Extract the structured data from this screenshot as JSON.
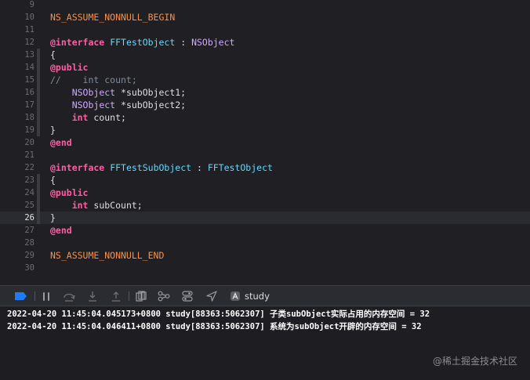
{
  "editor": {
    "current_line": 26,
    "lines": [
      {
        "n": "9",
        "bar": false,
        "tokens": []
      },
      {
        "n": "10",
        "bar": false,
        "tokens": [
          {
            "c": "t-macro",
            "t": "NS_ASSUME_NONNULL_BEGIN"
          }
        ]
      },
      {
        "n": "11",
        "bar": false,
        "tokens": []
      },
      {
        "n": "12",
        "bar": false,
        "tokens": [
          {
            "c": "t-kw",
            "t": "@interface"
          },
          {
            "c": "t-plain",
            "t": " "
          },
          {
            "c": "t-type",
            "t": "FFTestObject"
          },
          {
            "c": "t-plain",
            "t": " : "
          },
          {
            "c": "t-sys",
            "t": "NSObject"
          }
        ]
      },
      {
        "n": "13",
        "bar": true,
        "tokens": [
          {
            "c": "t-plain",
            "t": "{"
          }
        ]
      },
      {
        "n": "14",
        "bar": true,
        "tokens": [
          {
            "c": "t-kw",
            "t": "@public"
          }
        ]
      },
      {
        "n": "15",
        "bar": true,
        "tokens": [
          {
            "c": "t-cmt",
            "t": "//    int count;"
          }
        ]
      },
      {
        "n": "16",
        "bar": true,
        "tokens": [
          {
            "c": "t-plain",
            "t": "    "
          },
          {
            "c": "t-sys",
            "t": "NSObject"
          },
          {
            "c": "t-plain",
            "t": " *subObject1;"
          }
        ]
      },
      {
        "n": "17",
        "bar": true,
        "tokens": [
          {
            "c": "t-plain",
            "t": "    "
          },
          {
            "c": "t-sys",
            "t": "NSObject"
          },
          {
            "c": "t-plain",
            "t": " *subObject2;"
          }
        ]
      },
      {
        "n": "18",
        "bar": true,
        "tokens": [
          {
            "c": "t-plain",
            "t": "    "
          },
          {
            "c": "t-kw",
            "t": "int"
          },
          {
            "c": "t-plain",
            "t": " count;"
          }
        ]
      },
      {
        "n": "19",
        "bar": true,
        "tokens": [
          {
            "c": "t-plain",
            "t": "}"
          }
        ]
      },
      {
        "n": "20",
        "bar": false,
        "tokens": [
          {
            "c": "t-kw",
            "t": "@end"
          }
        ]
      },
      {
        "n": "21",
        "bar": false,
        "tokens": []
      },
      {
        "n": "22",
        "bar": false,
        "tokens": [
          {
            "c": "t-kw",
            "t": "@interface"
          },
          {
            "c": "t-plain",
            "t": " "
          },
          {
            "c": "t-type",
            "t": "FFTestSubObject"
          },
          {
            "c": "t-plain",
            "t": " : "
          },
          {
            "c": "t-type",
            "t": "FFTestObject"
          }
        ]
      },
      {
        "n": "23",
        "bar": true,
        "tokens": [
          {
            "c": "t-plain",
            "t": "{"
          }
        ]
      },
      {
        "n": "24",
        "bar": true,
        "tokens": [
          {
            "c": "t-kw",
            "t": "@public"
          }
        ]
      },
      {
        "n": "25",
        "bar": true,
        "tokens": [
          {
            "c": "t-plain",
            "t": "    "
          },
          {
            "c": "t-kw",
            "t": "int"
          },
          {
            "c": "t-plain",
            "t": " subCount;"
          }
        ]
      },
      {
        "n": "26",
        "bar": true,
        "tokens": [
          {
            "c": "t-plain",
            "t": "}"
          }
        ]
      },
      {
        "n": "27",
        "bar": false,
        "tokens": [
          {
            "c": "t-kw",
            "t": "@end"
          }
        ]
      },
      {
        "n": "28",
        "bar": false,
        "tokens": []
      },
      {
        "n": "29",
        "bar": false,
        "tokens": [
          {
            "c": "t-macro",
            "t": "NS_ASSUME_NONNULL_END"
          }
        ]
      },
      {
        "n": "30",
        "bar": false,
        "tokens": []
      }
    ]
  },
  "debug_bar": {
    "target_label": "study",
    "icons": [
      "breakpoints-toggle-icon",
      "pause-icon",
      "step-over-icon",
      "step-into-icon",
      "step-out-icon",
      "view-hierarchy-icon",
      "memory-graph-icon",
      "environment-overrides-icon",
      "simulate-location-icon",
      "app-target-icon"
    ]
  },
  "console": {
    "lines": [
      "2022-04-20 11:45:04.045173+0800 study[88363:5062307] 子类subObject实际占用的内存空间 = 32",
      "2022-04-20 11:45:04.046411+0800 study[88363:5062307] 系统为subObject开辟的内存空间 = 32"
    ]
  },
  "watermark": "@稀土掘金技术社区",
  "colors": {
    "background": "#1f1f24",
    "keyword": "#fc5fa3",
    "macro": "#fd8f3f",
    "project_type": "#5dd8ff",
    "system_type": "#d0a8ff",
    "comment": "#7f8c98",
    "breakpoint_toggle": "#1e7bff"
  }
}
